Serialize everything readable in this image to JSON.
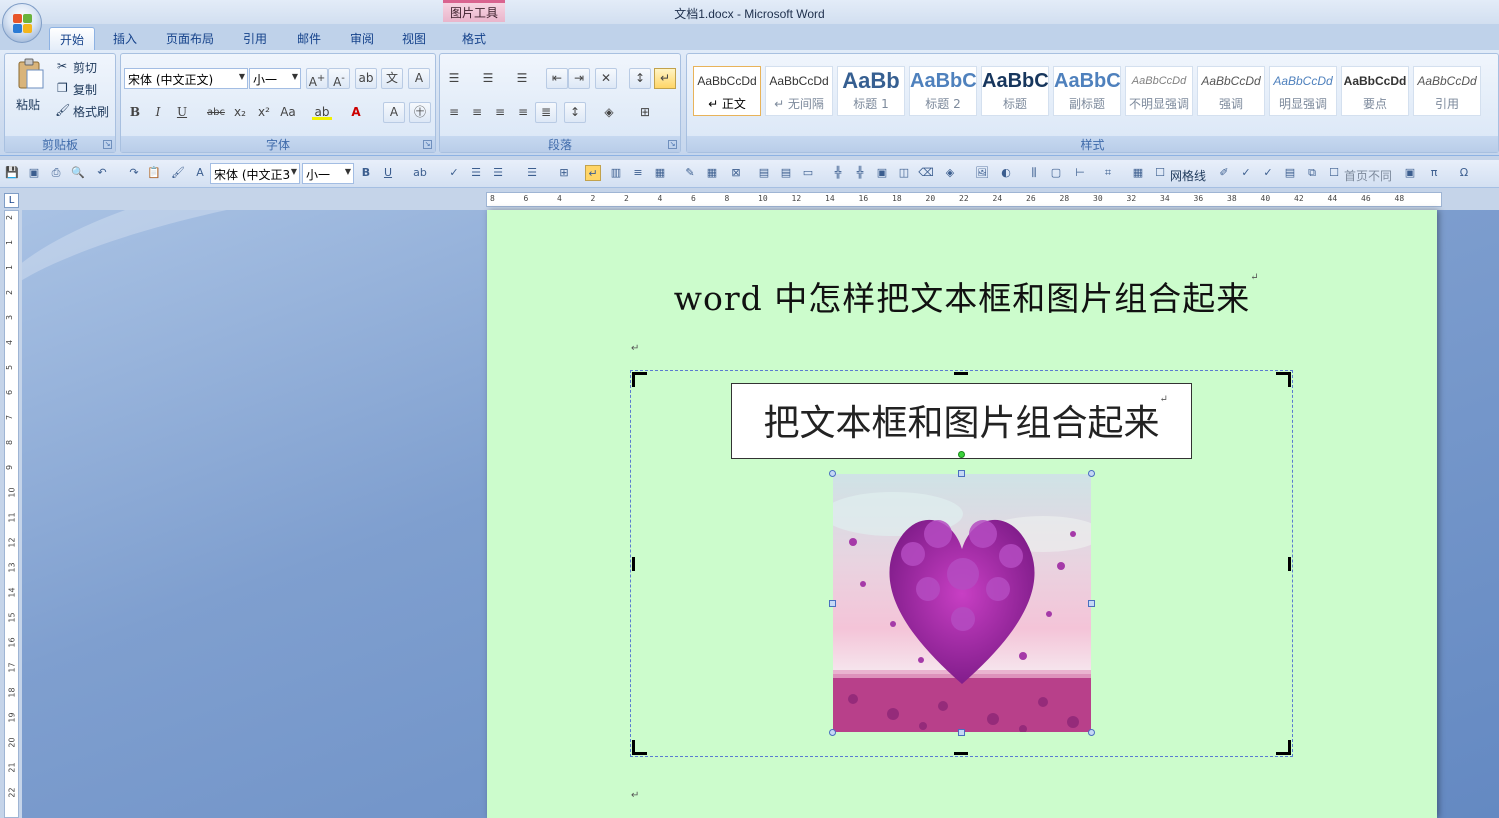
{
  "window": {
    "title": "文档1.docx - Microsoft Word"
  },
  "context_tab": {
    "group": "图片工具",
    "tab": "格式"
  },
  "tabs": [
    "开始",
    "插入",
    "页面布局",
    "引用",
    "邮件",
    "审阅",
    "视图"
  ],
  "clipboard": {
    "paste": "粘贴",
    "cut": "剪切",
    "copy": "复制",
    "format_painter": "格式刷",
    "label": "剪贴板"
  },
  "font": {
    "family": "宋体 (中文正文)",
    "size": "小一",
    "label": "字体"
  },
  "paragraph": {
    "label": "段落"
  },
  "styles": {
    "label": "样式",
    "items": [
      {
        "preview": "AaBbCcDd",
        "name": "↵ 正文"
      },
      {
        "preview": "AaBbCcDd",
        "name": "↵ 无间隔"
      },
      {
        "preview": "AaBb",
        "name": "标题 1"
      },
      {
        "preview": "AaBbC",
        "name": "标题 2"
      },
      {
        "preview": "AaBbC",
        "name": "标题"
      },
      {
        "preview": "AaBbC",
        "name": "副标题"
      },
      {
        "preview": "AaBbCcDd",
        "name": "不明显强调"
      },
      {
        "preview": "AaBbCcDd",
        "name": "强调"
      },
      {
        "preview": "AaBbCcDd",
        "name": "明显强调"
      },
      {
        "preview": "AaBbCcDd",
        "name": "要点"
      },
      {
        "preview": "AaBbCcDd",
        "name": "引用"
      }
    ]
  },
  "qat": {
    "font": "宋体 (中文正3",
    "size": "小一",
    "gridlines": "网格线",
    "first_page": "首页不同"
  },
  "ruler": {
    "marks": [
      "8",
      "6",
      "4",
      "2",
      "2",
      "4",
      "6",
      "8",
      "10",
      "12",
      "14",
      "16",
      "18",
      "20",
      "22",
      "24",
      "26",
      "28",
      "30",
      "32",
      "34",
      "36",
      "38",
      "40",
      "42",
      "44",
      "46",
      "48"
    ]
  },
  "vruler": {
    "marks": [
      "2",
      "1",
      "1",
      "2",
      "3",
      "4",
      "5",
      "6",
      "7",
      "8",
      "9",
      "10",
      "11",
      "12",
      "13",
      "14",
      "15",
      "16",
      "17",
      "18",
      "19",
      "20",
      "21",
      "22"
    ]
  },
  "document": {
    "title": "word 中怎样把文本框和图片组合起来",
    "textbox": "把文本框和图片组合起来",
    "para_mark": "↵"
  },
  "colors": {
    "page": "#ccfccc",
    "ribbon": "#d1def0",
    "accent": "#15428b"
  }
}
